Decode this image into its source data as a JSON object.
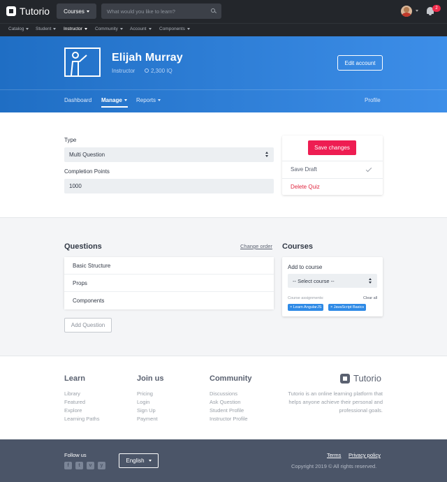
{
  "topbar": {
    "logo_text": "Tutorio",
    "courses_label": "Courses",
    "search_placeholder": "What would you like to learn?",
    "notification_count": "2"
  },
  "subnav": [
    "Catalog",
    "Student",
    "Instructor",
    "Community",
    "Account",
    "Components"
  ],
  "profile": {
    "name": "Elijah Murray",
    "role": "Instructor",
    "iq": "2,300 IQ",
    "edit_label": "Edit account"
  },
  "tabs": {
    "dashboard": "Dashboard",
    "manage": "Manage",
    "reports": "Reports",
    "profile": "Profile"
  },
  "form": {
    "type_label": "Type",
    "type_value": "Multi Question",
    "points_label": "Completion Points",
    "points_value": "1000"
  },
  "actions": {
    "save": "Save changes",
    "draft": "Save Draft",
    "delete": "Delete Quiz"
  },
  "questions": {
    "title": "Questions",
    "change_order": "Change order",
    "items": [
      "Basic Structure",
      "Props",
      "Components"
    ],
    "add_label": "Add Question"
  },
  "courses": {
    "title": "Courses",
    "add_label": "Add to course",
    "select_placeholder": "-- Select course --",
    "assignments_label": "Course assignments:",
    "clear_all": "Clear all",
    "tags": [
      "× Learn AngularJS",
      "× JavaScript Basics"
    ]
  },
  "footer": {
    "learn": {
      "title": "Learn",
      "links": [
        "Library",
        "Featured",
        "Explore",
        "Learning Paths"
      ]
    },
    "join": {
      "title": "Join us",
      "links": [
        "Pricing",
        "Login",
        "Sign Up",
        "Payment"
      ]
    },
    "community": {
      "title": "Community",
      "links": [
        "Discussions",
        "Ask Question",
        "Student Profile",
        "Instructor Profile"
      ]
    },
    "logo_text": "Tutorio",
    "description": "Tutorio is an online learning platform that helps anyone achieve their personal and professional goals."
  },
  "bottom": {
    "follow": "Follow us",
    "social": [
      "f",
      "t",
      "v",
      "y"
    ],
    "language": "English",
    "terms": "Terms",
    "privacy": "Privacy policy",
    "copyright": "Copyright 2019 © All rights reserved."
  },
  "colors": {
    "primary": "#2d7fe0",
    "danger": "#ee1d52",
    "dark": "#23262b",
    "footer_bar": "#4b5568"
  }
}
